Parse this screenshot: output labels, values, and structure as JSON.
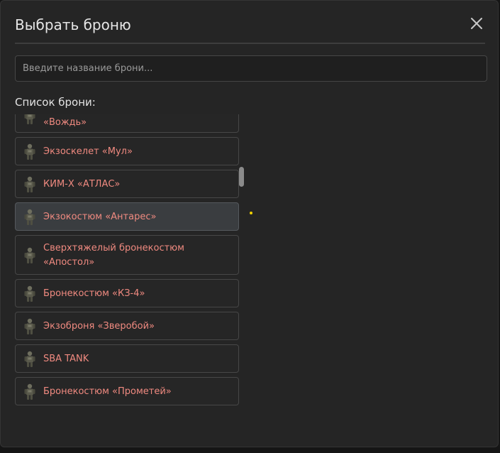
{
  "modal": {
    "title": "Выбрать броню",
    "close_icon": "close-icon"
  },
  "search": {
    "placeholder": "Введите название брони...",
    "value": ""
  },
  "list": {
    "label": "Список брони:",
    "items": [
      {
        "name": "«Вождь»",
        "icon": "armor-icon",
        "selected": false
      },
      {
        "name": "Экзоскелет «Мул»",
        "icon": "armor-icon",
        "selected": false
      },
      {
        "name": "КИМ-Х «АТЛАС»",
        "icon": "armor-icon",
        "selected": false
      },
      {
        "name": "Экзокостюм «Антарес»",
        "icon": "armor-icon",
        "selected": true
      },
      {
        "name": "Сверхтяжелый бронекостюм «Апостол»",
        "icon": "armor-icon",
        "selected": false
      },
      {
        "name": "Бронекостюм «КЗ-4»",
        "icon": "armor-icon",
        "selected": false
      },
      {
        "name": "Экзоброня «Зверобой»",
        "icon": "armor-icon",
        "selected": false
      },
      {
        "name": "SBA TANK",
        "icon": "armor-icon",
        "selected": false
      },
      {
        "name": "Бронекостюм «Прометей»",
        "icon": "armor-icon",
        "selected": false
      }
    ]
  },
  "colors": {
    "item_text": "#f08a80",
    "selected_bg": "#3a3d40",
    "modal_bg": "#252525"
  }
}
